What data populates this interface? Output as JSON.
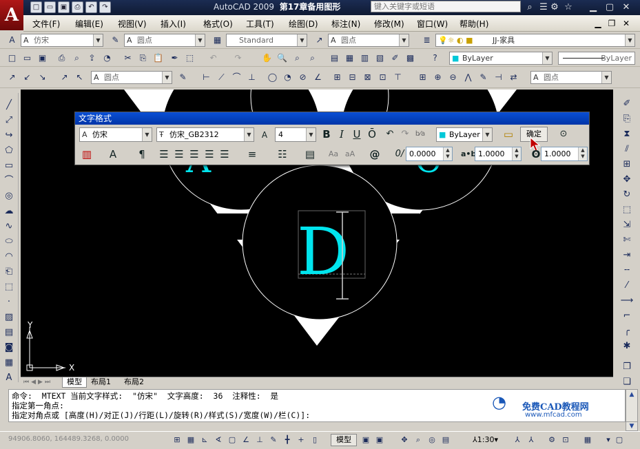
{
  "title": {
    "app": "AutoCAD 2009",
    "doc": "第17章备用图形",
    "search_placeholder": "键入关键字或短语"
  },
  "menu": [
    "文件(F)",
    "编辑(E)",
    "视图(V)",
    "插入(I)",
    "格式(O)",
    "工具(T)",
    "绘图(D)",
    "标注(N)",
    "修改(M)",
    "窗口(W)",
    "帮助(H)"
  ],
  "toolbar1": {
    "text_style": "仿宋",
    "dim_style": "圆点",
    "table_style": "Standard",
    "multileader_style": "圆点",
    "layer": "JJ-家具"
  },
  "toolbar2": {
    "color": "ByLayer",
    "linetype": "ByLayer"
  },
  "toolbar3": {
    "style_a": "圆点",
    "style_b": "圆点"
  },
  "text_format": {
    "title": "文字格式",
    "style": "仿宋",
    "font": "仿宋_GB2312",
    "height": "4",
    "bold": "B",
    "italic": "I",
    "underline": "U",
    "overline": "Ō",
    "color": "ByLayer",
    "ok": "确定",
    "oblique": "0.0000",
    "tracking": "1.0000",
    "width_factor": "1.0000",
    "symbol": "@"
  },
  "canvas": {
    "letter_d": "D",
    "letter_a": "A",
    "letter_c": "C",
    "ucs_x": "X",
    "ucs_y": "Y"
  },
  "layout_tabs": [
    "模型",
    "布局1",
    "布局2"
  ],
  "command_lines": [
    "命令:  MTEXT 当前文字样式:  \"仿宋\"  文字高度:  36  注释性:  是",
    "指定第一角点:",
    "指定对角点或 [高度(H)/对正(J)/行距(L)/旋转(R)/样式(S)/宽度(W)/栏(C)]:"
  ],
  "watermark": {
    "name": "免费CAD教程网",
    "url": "www.mfcad.com"
  },
  "status": {
    "coords": "94906.8060, 164489.3268, 0.0000",
    "model": "模型",
    "scale": "1:30"
  },
  "colors": {
    "title_bg": "#0f1a33",
    "dialog_head": "#0a4fd4",
    "drawing_text": "#00e5ee"
  }
}
